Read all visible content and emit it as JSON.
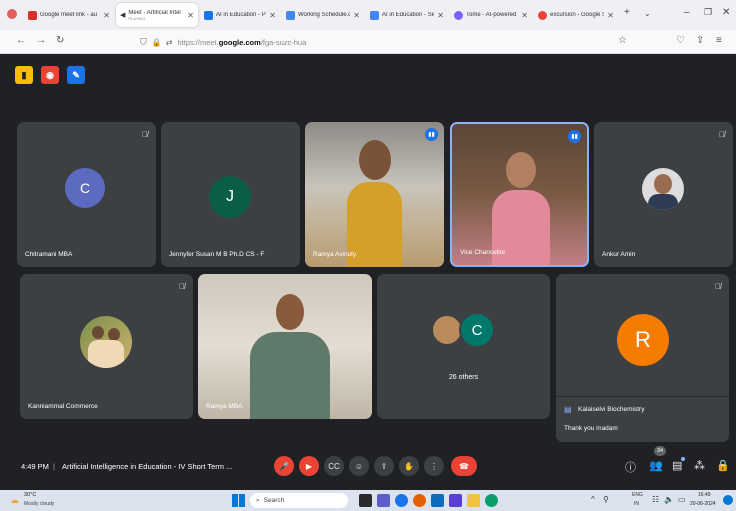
{
  "browser": {
    "tabs": [
      {
        "title": "Google meet link - au",
        "fav": "#d93025",
        "active": false
      },
      {
        "title": "Meet - Artificial Intel",
        "sub": "PLAYING",
        "fav": "#00832d",
        "active": true
      },
      {
        "title": "AI in Education - Proj",
        "fav": "#1a73e8",
        "active": false
      },
      {
        "title": "Working Schedule.doc",
        "fav": "#4285f4",
        "active": false
      },
      {
        "title": "AI in Education - Sess",
        "fav": "#4285f4",
        "active": false
      },
      {
        "title": "Tome - AI-powered st",
        "fav": "#7b61ff",
        "active": false
      },
      {
        "title": "excursion - Google Se",
        "fav": "#ea4335",
        "active": false
      }
    ],
    "url_prefix": "https://meet.",
    "url_domain": "google.com",
    "url_path": "/fga-suzc-hua"
  },
  "meeting": {
    "participants": [
      {
        "name": "Chitramani MBA",
        "initial": "C"
      },
      {
        "name": "Jennyfer Susan M B Ph.D CS - F",
        "initial": "J"
      },
      {
        "name": "Ramya Avinuty"
      },
      {
        "name": "Vice Chancellor"
      },
      {
        "name": "Ankur Amin"
      },
      {
        "name": "Kanniammal Commerce"
      },
      {
        "name": "Ramya MBA"
      },
      {
        "name": "R",
        "initial": "R"
      }
    ],
    "others_label": "26 others",
    "others_initial": "C",
    "chat": {
      "sender": "Kalaiselvi Biochemistry",
      "message": "Thank you madam"
    },
    "time": "4:49 PM",
    "separator": "|",
    "title": "Artificial Intelligence in Education - IV Short Term ...",
    "people_count": "34"
  },
  "taskbar": {
    "temperature": "30°C",
    "weather": "Mostly cloudy",
    "search_placeholder": "Search",
    "lang": "ENG",
    "lang2": "IN",
    "clock": "16:49",
    "date": "20-06-2024"
  },
  "colors": {
    "meet_bg": "#202124",
    "tile_bg": "#3c4043",
    "accent_red": "#ea4335",
    "accent_blue": "#1a73e8"
  }
}
